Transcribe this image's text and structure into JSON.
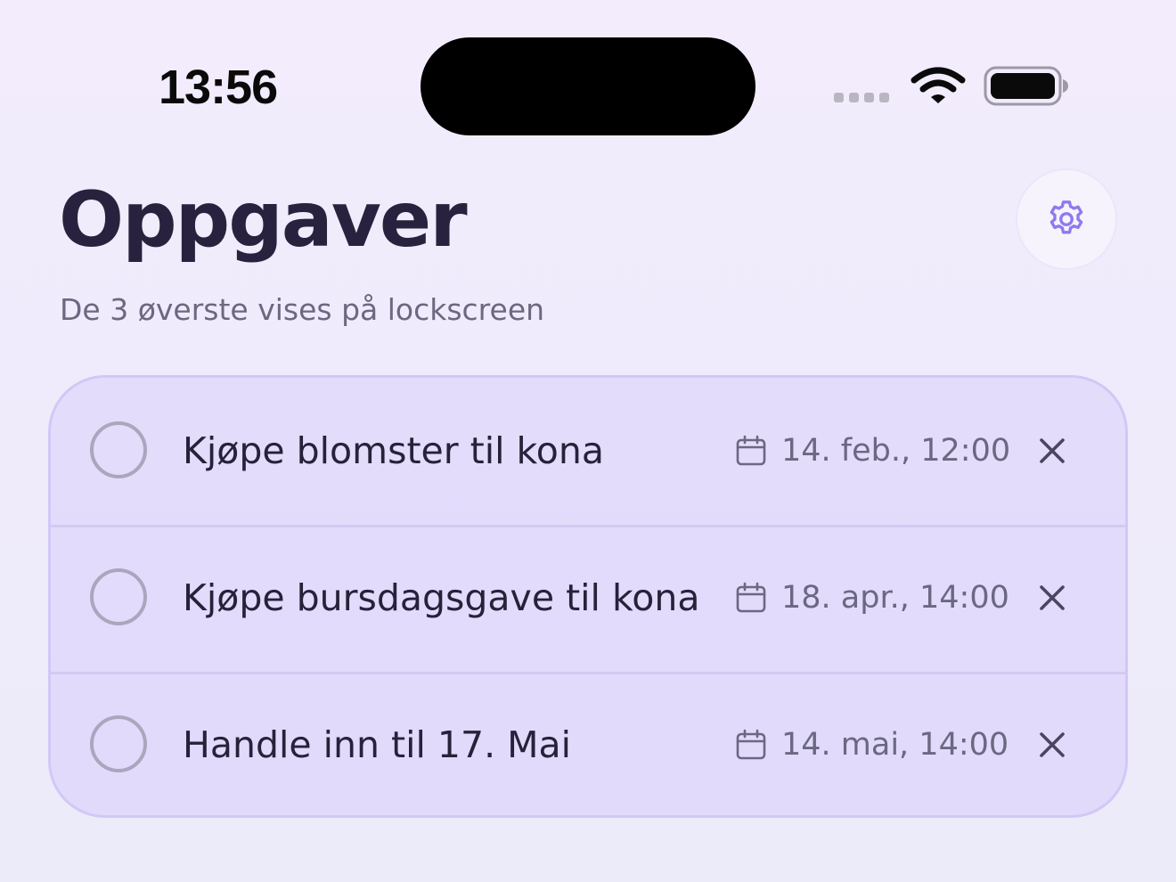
{
  "status_bar": {
    "time": "13:56",
    "signal_icon": "signal-bars-icon",
    "wifi_icon": "wifi-icon",
    "battery_icon": "battery-icon",
    "battery_level": 1.0
  },
  "header": {
    "title": "Oppgaver",
    "subtitle": "De 3 øverste vises på lockscreen",
    "settings_icon": "gear-icon"
  },
  "colors": {
    "accent": "#8f79ee",
    "title": "#28223e",
    "muted": "#6c6880",
    "card_border": "#d2c8f6"
  },
  "tasks": [
    {
      "title": "Kjøpe blomster til kona",
      "date": "14. feb., 12:00",
      "completed": false
    },
    {
      "title": "Kjøpe bursdagsgave til kona",
      "date": "18. apr., 14:00",
      "completed": false
    },
    {
      "title": "Handle inn til 17. Mai",
      "date": "14. mai, 14:00",
      "completed": false
    }
  ]
}
